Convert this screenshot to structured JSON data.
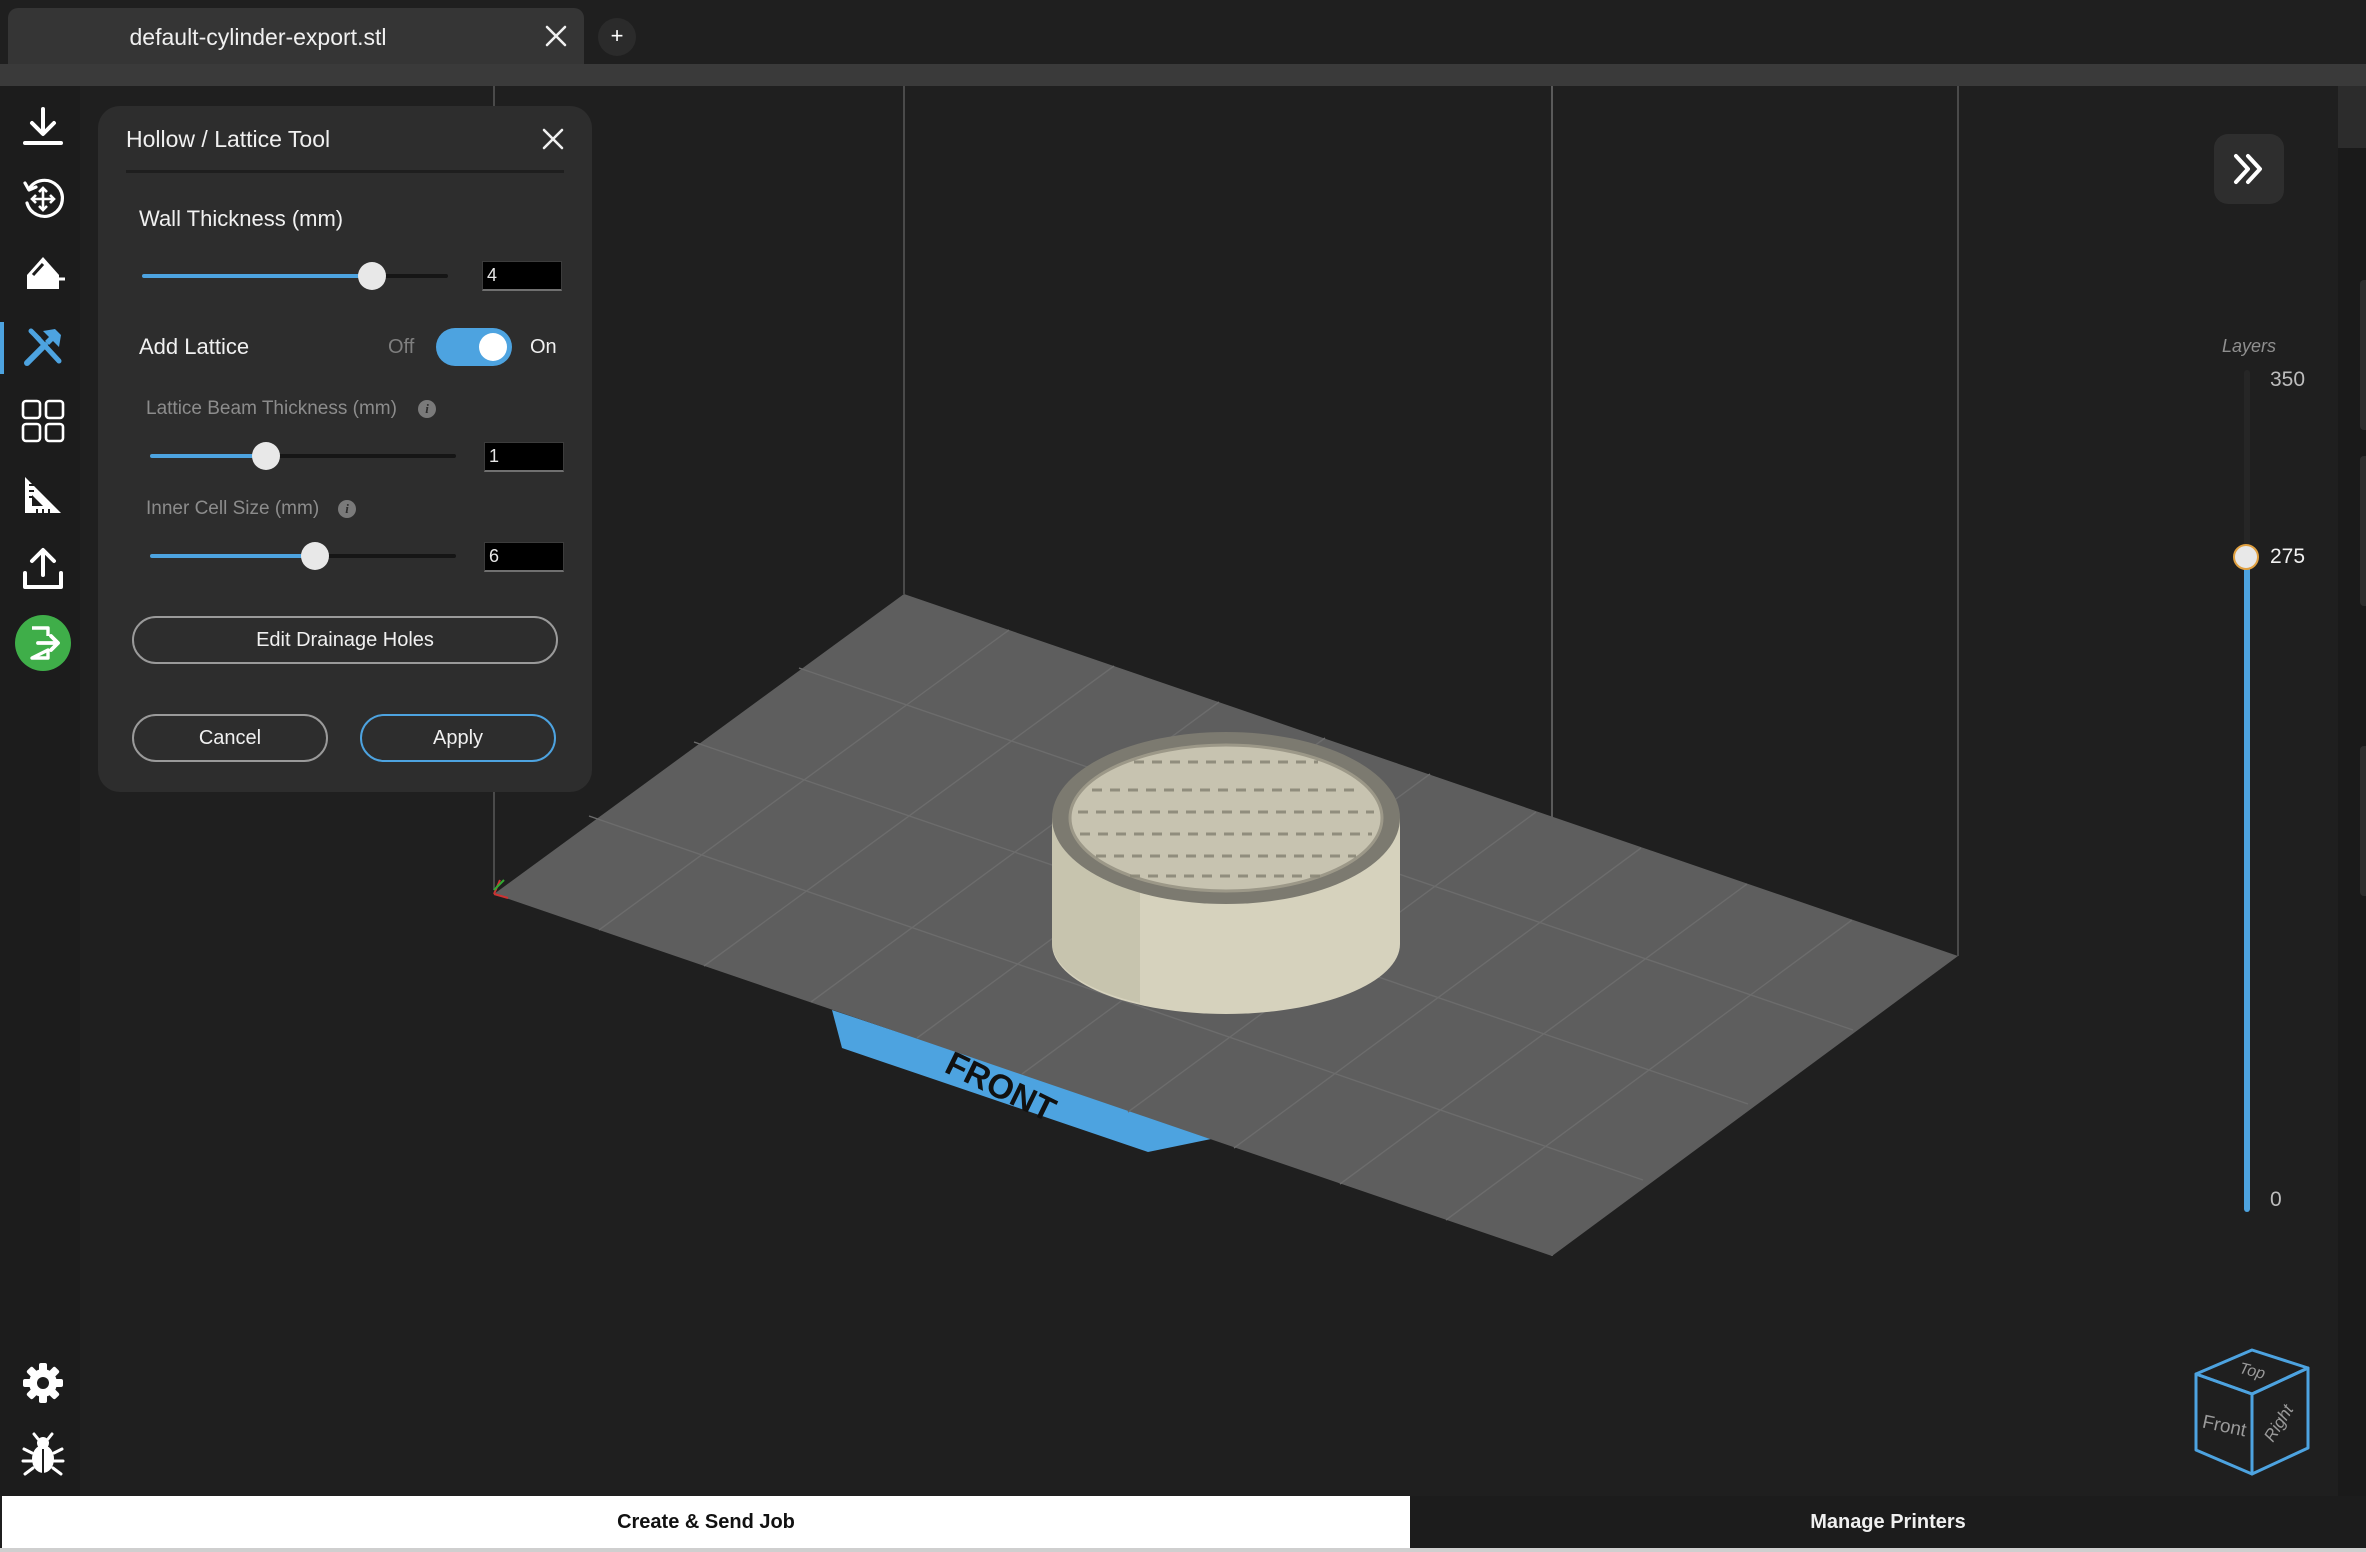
{
  "tab": {
    "title": "default-cylinder-export.stl",
    "new_tab_label": "+"
  },
  "toolbar": {
    "items": [
      {
        "name": "import",
        "icon": "download-icon"
      },
      {
        "name": "move-rotate",
        "icon": "move-rotate-icon"
      },
      {
        "name": "paint",
        "icon": "paint-fill-icon"
      },
      {
        "name": "tools",
        "icon": "tools-icon",
        "active": true
      },
      {
        "name": "arrange",
        "icon": "grid-icon"
      },
      {
        "name": "measure",
        "icon": "ruler-triangle-icon"
      },
      {
        "name": "export",
        "icon": "upload-icon"
      },
      {
        "name": "exit-tool",
        "icon": "exit-icon"
      }
    ],
    "bottom_items": [
      {
        "name": "settings",
        "icon": "gear-icon"
      },
      {
        "name": "debug",
        "icon": "bug-icon"
      }
    ]
  },
  "panel": {
    "title": "Hollow / Lattice Tool",
    "wall_thickness": {
      "label": "Wall Thickness (mm)",
      "value": "4",
      "fraction": 0.75
    },
    "lattice": {
      "label": "Add Lattice",
      "off_label": "Off",
      "on_label": "On",
      "enabled": true
    },
    "beam_thickness": {
      "label": "Lattice Beam Thickness (mm)",
      "value": "1",
      "fraction": 0.38
    },
    "cell_size": {
      "label": "Inner Cell Size (mm)",
      "value": "6",
      "fraction": 0.54
    },
    "drainage_button": "Edit Drainage Holes",
    "cancel_button": "Cancel",
    "apply_button": "Apply"
  },
  "viewport": {
    "plate_label": "FRONT",
    "cube_faces": {
      "top": "Top",
      "front": "Front",
      "right": "Right"
    }
  },
  "layers": {
    "label": "Layers",
    "max": "350",
    "current": "275",
    "min": "0",
    "max_value": 350,
    "current_value": 275
  },
  "bottom": {
    "create_label": "Create & Send Job",
    "manage_label": "Manage Printers"
  },
  "colors": {
    "accent": "#4da3e0",
    "exit_green": "#3fae49",
    "plate": "#5e5e5e",
    "model": "#d6d2bd"
  }
}
